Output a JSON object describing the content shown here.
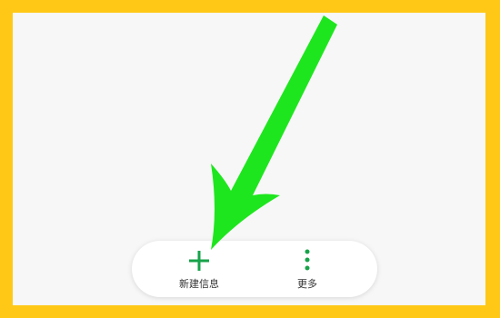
{
  "bottom_bar": {
    "new_message": {
      "label": "新建信息",
      "icon": "plus-icon"
    },
    "more": {
      "label": "更多",
      "icon": "more-vertical-icon"
    }
  },
  "colors": {
    "border": "#ffc816",
    "screen_background": "#f7f7f7",
    "icon_green": "#17a34a",
    "arrow": "#1ee61e"
  },
  "annotation": {
    "icon": "pointer-arrow-icon"
  }
}
